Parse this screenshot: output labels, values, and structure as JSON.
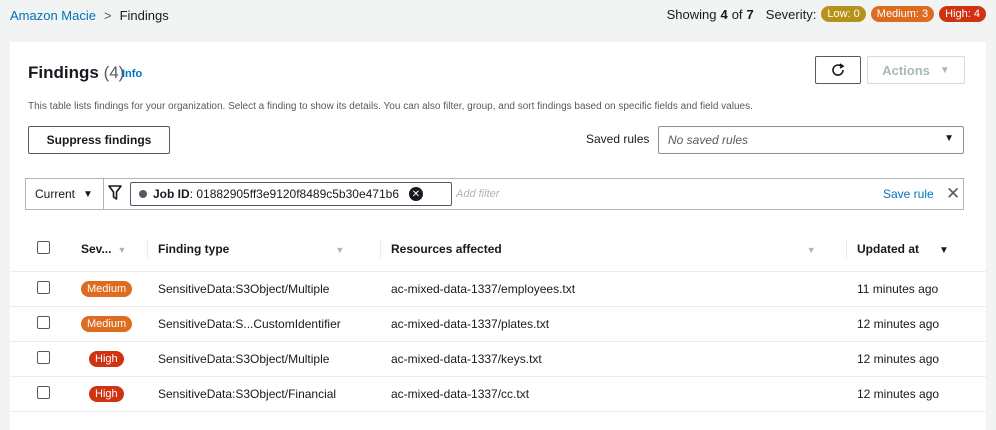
{
  "breadcrumb": {
    "root": "Amazon Macie",
    "current": "Findings"
  },
  "summary": {
    "showing_prefix": "Showing",
    "shown": "4",
    "of_word": "of",
    "total": "7",
    "severity_label": "Severity:",
    "low": "Low: 0",
    "medium": "Medium: 3",
    "high": "High: 4"
  },
  "panel": {
    "title": "Findings",
    "count": "(4)",
    "info": "Info",
    "description": "This table lists findings for your organization. Select a finding to show its details. You can also filter, group, and sort findings based on specific fields and field values.",
    "actions": "Actions",
    "suppress": "Suppress findings",
    "saved_rules_label": "Saved rules",
    "saved_rules_placeholder": "No saved rules"
  },
  "filter": {
    "scope": "Current",
    "token_key": "Job ID",
    "token_value": ": 01882905ff3e9120f8489c5b30e471b6",
    "placeholder": "Add filter",
    "save_rule": "Save rule"
  },
  "table": {
    "headers": {
      "severity": "Sev...",
      "finding_type": "Finding type",
      "resources": "Resources affected",
      "updated": "Updated at"
    },
    "rows": [
      {
        "severity": "Medium",
        "type": "SensitiveData:S3Object/Multiple",
        "resource": "ac-mixed-data-1337/employees.txt",
        "updated": "11 minutes ago"
      },
      {
        "severity": "Medium",
        "type": "SensitiveData:S...CustomIdentifier",
        "resource": "ac-mixed-data-1337/plates.txt",
        "updated": "12 minutes ago"
      },
      {
        "severity": "High",
        "type": "SensitiveData:S3Object/Multiple",
        "resource": "ac-mixed-data-1337/keys.txt",
        "updated": "12 minutes ago"
      },
      {
        "severity": "High",
        "type": "SensitiveData:S3Object/Financial",
        "resource": "ac-mixed-data-1337/cc.txt",
        "updated": "12 minutes ago"
      }
    ]
  }
}
